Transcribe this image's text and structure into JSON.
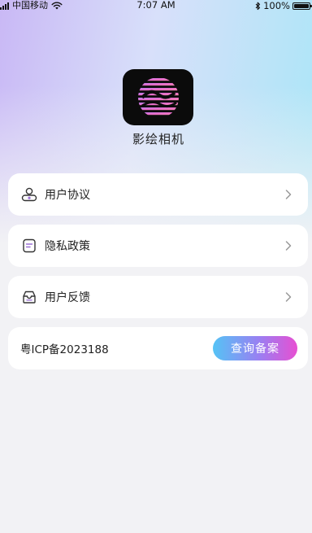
{
  "status_bar": {
    "carrier": "中国移动",
    "time": "7:07 AM",
    "battery": "100%",
    "icons": [
      "signal-icon",
      "wifi-icon",
      "bluetooth-icon",
      "battery-icon"
    ]
  },
  "app": {
    "name": "影绘相机",
    "logo_icon": "app-logo"
  },
  "menu": {
    "items": [
      {
        "label": "用户协议",
        "icon": "user-agreement-icon"
      },
      {
        "label": "隐私政策",
        "icon": "privacy-policy-icon"
      },
      {
        "label": "用户反馈",
        "icon": "feedback-icon"
      }
    ]
  },
  "icp": {
    "number": "粤ICP备2023188",
    "button_label": "查询备案"
  },
  "colors": {
    "accent_gradient_start": "#55c3f5",
    "accent_gradient_end": "#e74fd2",
    "icon_purple": "#9a6fd6",
    "icon_dark": "#333333"
  }
}
